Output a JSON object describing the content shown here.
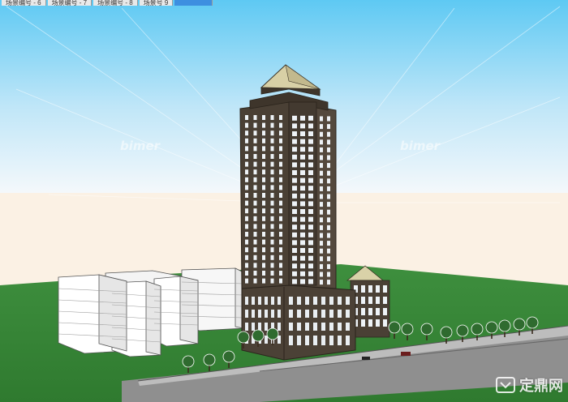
{
  "scene_tabs": [
    {
      "label": "场景编号 - 6"
    },
    {
      "label": "场景编号 - 7"
    },
    {
      "label": "场景编号 - 8"
    },
    {
      "label": "场景号 9"
    },
    {
      "label": "",
      "active": true
    }
  ],
  "watermarks": [
    "bimer",
    "bimer"
  ],
  "logo": {
    "text": "定鼎网"
  },
  "colors": {
    "sky_top": "#5ec9f3",
    "sky_bottom": "#f0f7ff",
    "horizon": "#fbf1e4",
    "ground": "#3c8c3c",
    "road": "#8d8d8d",
    "facade": "#4a4035",
    "window": "#eef3f7",
    "roof": "#d6cfa8",
    "tree": "#2f6b2f",
    "tab_active": "#3d8fe0"
  },
  "icons": [
    "logo-icon"
  ]
}
